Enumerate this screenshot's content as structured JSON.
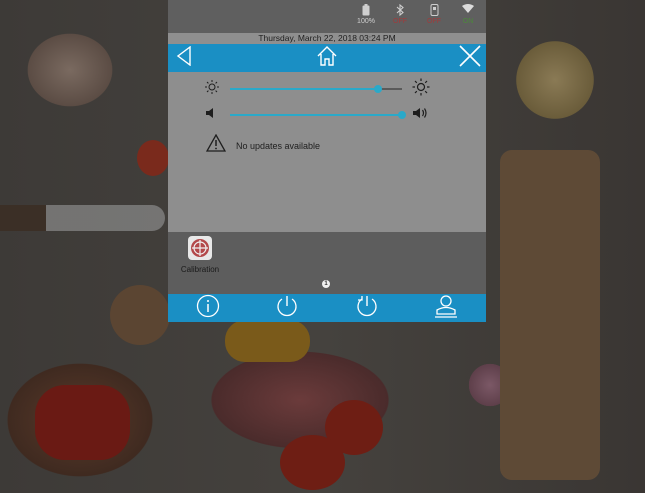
{
  "status": {
    "battery": {
      "icon": "battery-icon",
      "label": "100%"
    },
    "bluetooth": {
      "icon": "bluetooth-icon",
      "label": "OFF"
    },
    "usb": {
      "icon": "usb-icon",
      "label": "OFF"
    },
    "wifi": {
      "icon": "wifi-icon",
      "label": "ON"
    }
  },
  "datetime": "Thursday, March 22, 2018 03:24 PM",
  "nav": {
    "back_icon": "back-triangle-icon",
    "home_icon": "home-icon",
    "close_icon": "close-icon"
  },
  "settings": {
    "brightness": {
      "min_icon": "brightness-low-icon",
      "max_icon": "brightness-high-icon",
      "level_fraction": 0.86
    },
    "volume": {
      "min_icon": "volume-low-icon",
      "max_icon": "volume-high-icon",
      "level_fraction": 1.0
    },
    "update_message": "No updates available",
    "update_icon": "warning-icon"
  },
  "apps": [
    {
      "label": "Calibration",
      "icon": "calibration-icon"
    }
  ],
  "page_indicator": "1",
  "bottom_bar": [
    "info-icon",
    "power-icon",
    "restart-icon",
    "user-icon"
  ],
  "colors": {
    "accent": "#1a8fc4",
    "slider": "#2aa9c9",
    "off": "#a23a3a",
    "on": "#4c8a3a"
  }
}
